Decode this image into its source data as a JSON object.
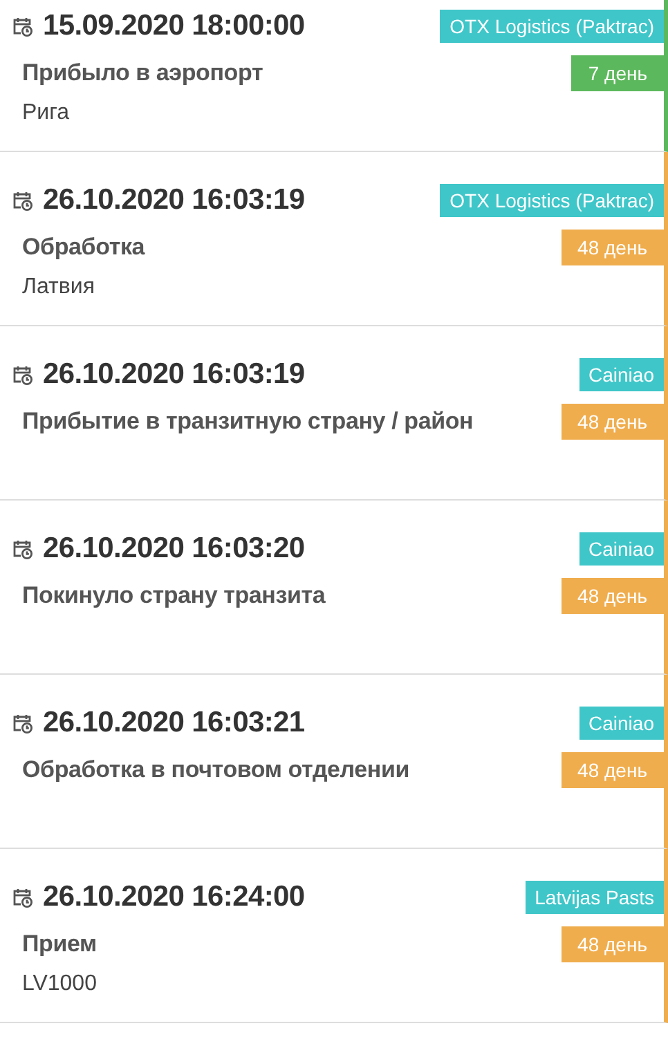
{
  "events": [
    {
      "datetime": "15.09.2020 18:00:00",
      "carrier": "OTX Logistics (Paktrac)",
      "status": "Прибыло в аэропорт",
      "days": "7 день",
      "color": "#5cb85c",
      "location": "Рига"
    },
    {
      "datetime": "26.10.2020 16:03:19",
      "carrier": "OTX Logistics (Paktrac)",
      "status": "Обработка",
      "days": "48 день",
      "color": "#f0ad4e",
      "location": "Латвия"
    },
    {
      "datetime": "26.10.2020 16:03:19",
      "carrier": "Cainiao",
      "status": "Прибытие в транзитную страну / район",
      "days": "48 день",
      "color": "#f0ad4e"
    },
    {
      "datetime": "26.10.2020 16:03:20",
      "carrier": "Cainiao",
      "status": "Покинуло страну транзита",
      "days": "48 день",
      "color": "#f0ad4e"
    },
    {
      "datetime": "26.10.2020 16:03:21",
      "carrier": "Cainiao",
      "status": "Обработка в почтовом отделении",
      "days": "48 день",
      "color": "#f0ad4e"
    },
    {
      "datetime": "26.10.2020 16:24:00",
      "carrier": "Latvijas Pasts",
      "status": "Прием",
      "days": "48 день",
      "color": "#f0ad4e",
      "location": "LV1000"
    }
  ]
}
